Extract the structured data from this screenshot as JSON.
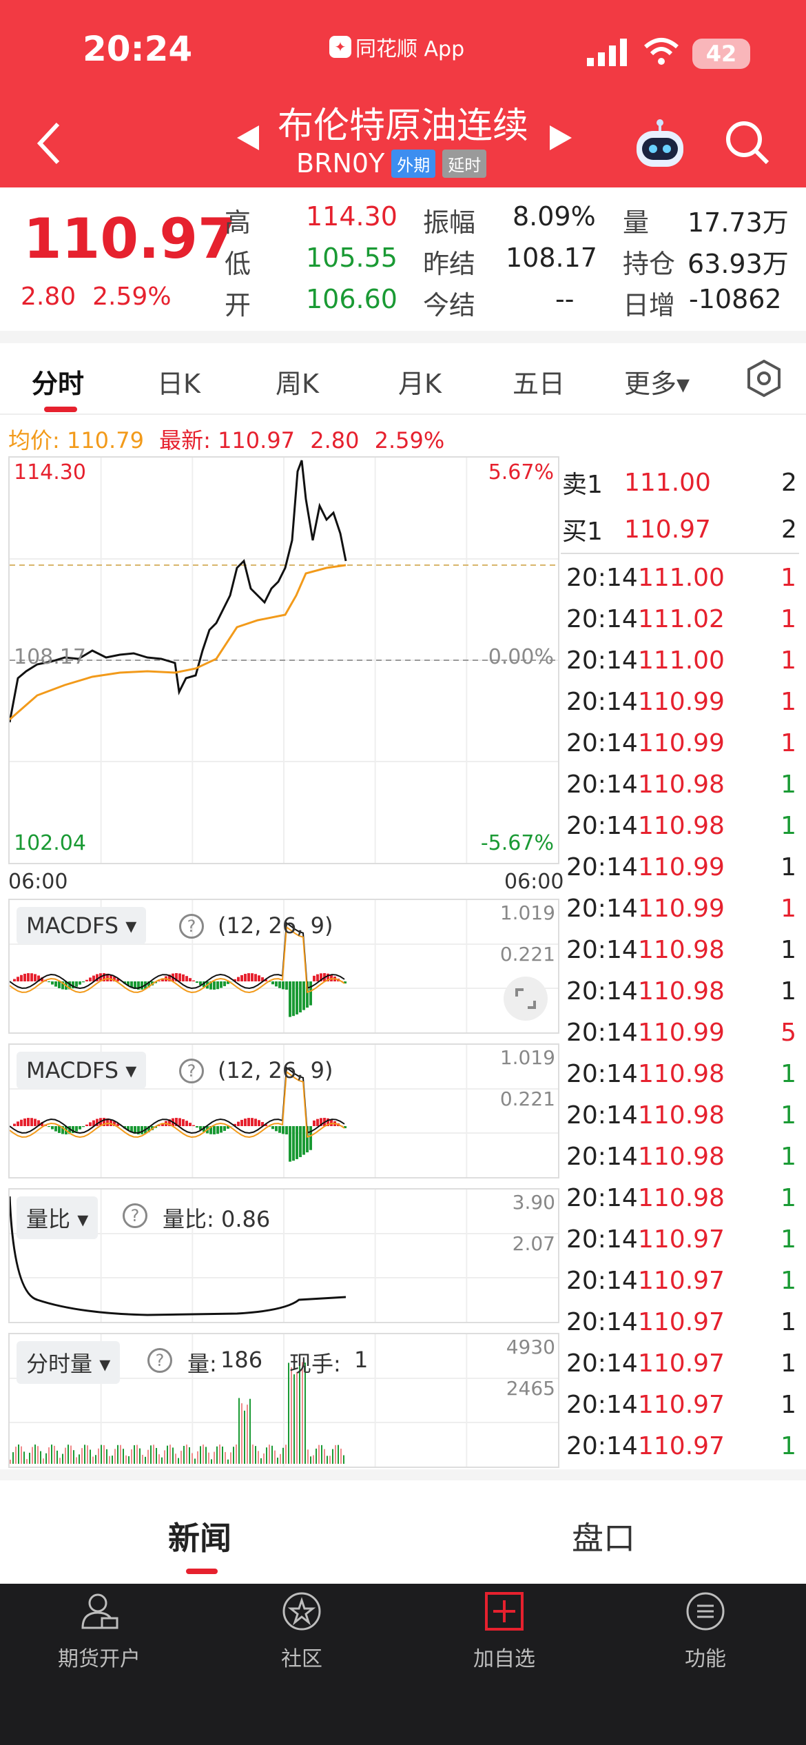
{
  "status": {
    "time": "20:24",
    "app_name": "同花顺 App",
    "battery": "42"
  },
  "header": {
    "title": "布伦特原油连续",
    "code": "BRN0Y",
    "tag_foreign": "外期",
    "tag_delay": "延时"
  },
  "quote": {
    "price": "110.97",
    "change": "2.80",
    "change_pct": "2.59%",
    "high_label": "高",
    "high": "114.30",
    "low_label": "低",
    "low": "105.55",
    "open_label": "开",
    "open": "106.60",
    "amp_label": "振幅",
    "amp": "8.09%",
    "prev_settle_label": "昨结",
    "prev_settle": "108.17",
    "settle_label": "今结",
    "settle": "--",
    "vol_label": "量",
    "vol": "17.73万",
    "oi_label": "持仓",
    "oi": "63.93万",
    "daily_inc_label": "日增",
    "daily_inc": "-10862"
  },
  "tabs": [
    "分时",
    "日K",
    "周K",
    "月K",
    "五日",
    "更多▾"
  ],
  "legend": {
    "avg_label": "均价: 110.79",
    "latest_label": "最新: 110.97",
    "chg": "2.80",
    "pct": "2.59%"
  },
  "price_chart": {
    "top_price": "114.30",
    "bottom_price": "102.04",
    "top_pct": "5.67%",
    "bottom_pct": "-5.67%",
    "zero_pct": "0.00%",
    "mid_price": "108.17",
    "time_left": "06:00",
    "time_right": "06:00"
  },
  "chart_data": {
    "type": "line",
    "title": "",
    "series": [],
    "ylim": [
      102.04,
      114.3
    ],
    "prev_settle": 108.17
  },
  "panels": {
    "macd1": {
      "name": "MACDFS",
      "params": "(12, 26, 9)",
      "t1": "1.019",
      "t2": "0.221"
    },
    "macd2": {
      "name": "MACDFS",
      "params": "(12, 26, 9)",
      "t1": "1.019",
      "t2": "0.221"
    },
    "ratio": {
      "name": "量比",
      "value_label": "量比: 0.86",
      "t1": "3.90",
      "t2": "2.07"
    },
    "volume": {
      "name": "分时量",
      "vol_label": "量:",
      "vol_value": "186",
      "hand_label": "现手:",
      "hand_value": "1",
      "t1": "4930",
      "t2": "2465"
    }
  },
  "orderbook": {
    "sell1_label": "卖1",
    "sell1_price": "111.00",
    "sell1_vol": "2",
    "buy1_label": "买1",
    "buy1_price": "110.97",
    "buy1_vol": "2",
    "trades": [
      {
        "time": "20:14",
        "price": "111.00",
        "vol": "1",
        "dir": "up"
      },
      {
        "time": "20:14",
        "price": "111.02",
        "vol": "1",
        "dir": "up"
      },
      {
        "time": "20:14",
        "price": "111.00",
        "vol": "1",
        "dir": "up"
      },
      {
        "time": "20:14",
        "price": "110.99",
        "vol": "1",
        "dir": "up"
      },
      {
        "time": "20:14",
        "price": "110.99",
        "vol": "1",
        "dir": "up"
      },
      {
        "time": "20:14",
        "price": "110.98",
        "vol": "1",
        "dir": "down"
      },
      {
        "time": "20:14",
        "price": "110.98",
        "vol": "1",
        "dir": "down"
      },
      {
        "time": "20:14",
        "price": "110.99",
        "vol": "1",
        "dir": "neutral"
      },
      {
        "time": "20:14",
        "price": "110.99",
        "vol": "1",
        "dir": "up"
      },
      {
        "time": "20:14",
        "price": "110.98",
        "vol": "1",
        "dir": "neutral"
      },
      {
        "time": "20:14",
        "price": "110.98",
        "vol": "1",
        "dir": "neutral"
      },
      {
        "time": "20:14",
        "price": "110.99",
        "vol": "5",
        "dir": "up"
      },
      {
        "time": "20:14",
        "price": "110.98",
        "vol": "1",
        "dir": "down"
      },
      {
        "time": "20:14",
        "price": "110.98",
        "vol": "1",
        "dir": "down"
      },
      {
        "time": "20:14",
        "price": "110.98",
        "vol": "1",
        "dir": "down"
      },
      {
        "time": "20:14",
        "price": "110.98",
        "vol": "1",
        "dir": "down"
      },
      {
        "time": "20:14",
        "price": "110.97",
        "vol": "1",
        "dir": "down"
      },
      {
        "time": "20:14",
        "price": "110.97",
        "vol": "1",
        "dir": "down"
      },
      {
        "time": "20:14",
        "price": "110.97",
        "vol": "1",
        "dir": "neutral"
      },
      {
        "time": "20:14",
        "price": "110.97",
        "vol": "1",
        "dir": "neutral"
      },
      {
        "time": "20:14",
        "price": "110.97",
        "vol": "1",
        "dir": "neutral"
      },
      {
        "time": "20:14",
        "price": "110.97",
        "vol": "1",
        "dir": "down"
      }
    ]
  },
  "news_tabs": {
    "news": "新闻",
    "book": "盘口"
  },
  "tabbar": [
    {
      "label": "期货开户",
      "icon": "person-card-icon"
    },
    {
      "label": "社区",
      "icon": "community-star-icon"
    },
    {
      "label": "加自选",
      "icon": "add-watchlist-icon"
    },
    {
      "label": "功能",
      "icon": "menu-icon"
    }
  ],
  "colors": {
    "red": "#e6212e",
    "green": "#1a9a34",
    "header_red": "#f23a43",
    "avg_orange": "#f29a1a"
  }
}
